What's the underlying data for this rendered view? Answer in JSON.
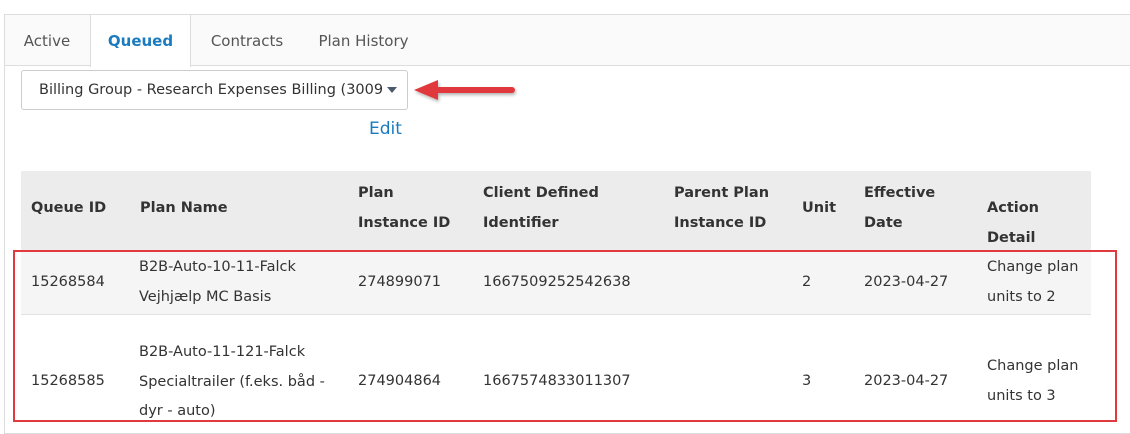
{
  "tabs": [
    {
      "label": "Active"
    },
    {
      "label": "Queued"
    },
    {
      "label": "Contracts"
    },
    {
      "label": "Plan History"
    }
  ],
  "billing_group": {
    "selected": "Billing Group - Research Expenses Billing (3009("
  },
  "edit_label": "Edit",
  "table": {
    "headers": {
      "queue_id": "Queue ID",
      "plan_name": "Plan Name",
      "plan_instance_id_1": "Plan",
      "plan_instance_id_2": "Instance ID",
      "client_defined_1": "Client Defined",
      "client_defined_2": "Identifier",
      "parent_plan_1": "Parent Plan",
      "parent_plan_2": "Instance ID",
      "unit": "Unit",
      "effective_1": "Effective",
      "effective_2": "Date",
      "action_detail": "Action Detail"
    },
    "rows": [
      {
        "queue_id": "15268584",
        "plan_name_1": "B2B-Auto-10-11-Falck",
        "plan_name_2": "Vejhjælp MC Basis",
        "plan_name_3": "",
        "plan_instance_id": "274899071",
        "client_defined_identifier": "1667509252542638",
        "parent_plan_instance_id": "",
        "unit": "2",
        "effective_date": "2023-04-27",
        "action_1": "Change plan",
        "action_2": "units to 2"
      },
      {
        "queue_id": "15268585",
        "plan_name_1": "B2B-Auto-11-121-Falck",
        "plan_name_2": "Specialtrailer (f.eks. båd -",
        "plan_name_3": "dyr - auto)",
        "plan_instance_id": "274904864",
        "client_defined_identifier": "1667574833011307",
        "parent_plan_instance_id": "",
        "unit": "3",
        "effective_date": "2023-04-27",
        "action_1": "Change plan",
        "action_2": "units to 3"
      }
    ]
  },
  "colors": {
    "accent": "#1a7bbf",
    "annotation_red": "#e0393e"
  }
}
